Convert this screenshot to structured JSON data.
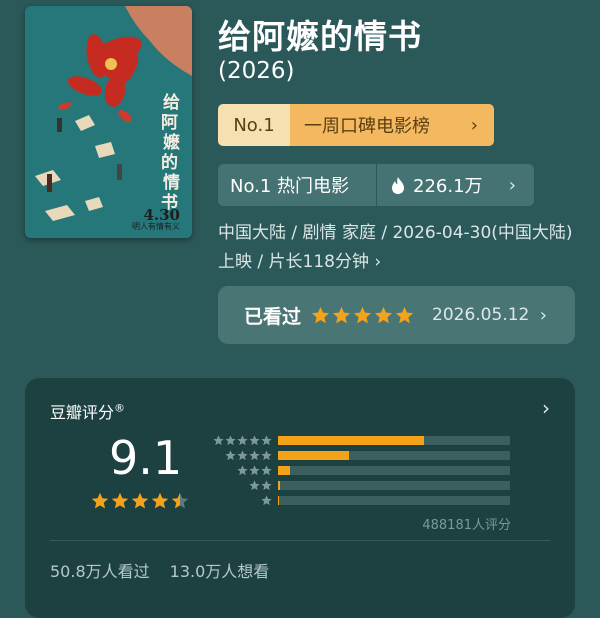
{
  "movie": {
    "title": "给阿嬷的情书",
    "year": "(2026)",
    "poster": {
      "vertical_title": [
        "给",
        "阿",
        "嬷",
        "的",
        "情",
        "书"
      ],
      "release": "4.30",
      "subtitle": "明人有情有义"
    },
    "rank_badge": {
      "no": "No.1",
      "label": "一周口碑电影榜",
      "chevron": "chevron-right-icon"
    },
    "hot_badge": {
      "label": "No.1 热门电影",
      "icon": "flame-icon",
      "count": "226.1万",
      "chevron": "chevron-right-icon"
    },
    "meta_text": "中国大陆 / 剧情 家庭 / 2026-04-30(中国大陆)上映 / 片长118分钟",
    "meta_chevron": "›",
    "watched": {
      "label": "已看过",
      "stars": 5,
      "date": "2026.05.12"
    }
  },
  "rating": {
    "title": "豆瓣评分",
    "mark": "®",
    "score": "9.1",
    "score_stars": 4.5,
    "distribution": [
      {
        "stars": 5,
        "fraction": 0.63
      },
      {
        "stars": 4,
        "fraction": 0.305
      },
      {
        "stars": 3,
        "fraction": 0.05
      },
      {
        "stars": 2,
        "fraction": 0.008
      },
      {
        "stars": 1,
        "fraction": 0.004
      }
    ],
    "count": "488181人评分",
    "watched": "50.8万人看过",
    "want": "13.0万人想看"
  },
  "colors": {
    "background": "#2b5858",
    "star": "#f3a21a",
    "rank_badge_light": "#f6e0b0",
    "rank_badge_dark": "#f4b860",
    "card": "#1d4141"
  }
}
